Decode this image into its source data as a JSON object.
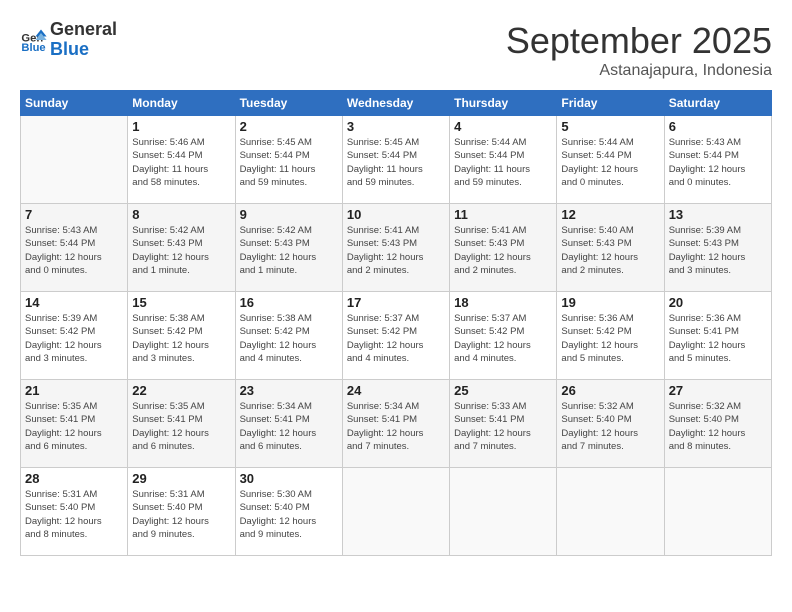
{
  "header": {
    "logo_line1": "General",
    "logo_line2": "Blue",
    "month": "September 2025",
    "location": "Astanajapura, Indonesia"
  },
  "days_of_week": [
    "Sunday",
    "Monday",
    "Tuesday",
    "Wednesday",
    "Thursday",
    "Friday",
    "Saturday"
  ],
  "weeks": [
    [
      {
        "day": "",
        "info": ""
      },
      {
        "day": "1",
        "info": "Sunrise: 5:46 AM\nSunset: 5:44 PM\nDaylight: 11 hours\nand 58 minutes."
      },
      {
        "day": "2",
        "info": "Sunrise: 5:45 AM\nSunset: 5:44 PM\nDaylight: 11 hours\nand 59 minutes."
      },
      {
        "day": "3",
        "info": "Sunrise: 5:45 AM\nSunset: 5:44 PM\nDaylight: 11 hours\nand 59 minutes."
      },
      {
        "day": "4",
        "info": "Sunrise: 5:44 AM\nSunset: 5:44 PM\nDaylight: 11 hours\nand 59 minutes."
      },
      {
        "day": "5",
        "info": "Sunrise: 5:44 AM\nSunset: 5:44 PM\nDaylight: 12 hours\nand 0 minutes."
      },
      {
        "day": "6",
        "info": "Sunrise: 5:43 AM\nSunset: 5:44 PM\nDaylight: 12 hours\nand 0 minutes."
      }
    ],
    [
      {
        "day": "7",
        "info": "Sunrise: 5:43 AM\nSunset: 5:44 PM\nDaylight: 12 hours\nand 0 minutes."
      },
      {
        "day": "8",
        "info": "Sunrise: 5:42 AM\nSunset: 5:43 PM\nDaylight: 12 hours\nand 1 minute."
      },
      {
        "day": "9",
        "info": "Sunrise: 5:42 AM\nSunset: 5:43 PM\nDaylight: 12 hours\nand 1 minute."
      },
      {
        "day": "10",
        "info": "Sunrise: 5:41 AM\nSunset: 5:43 PM\nDaylight: 12 hours\nand 2 minutes."
      },
      {
        "day": "11",
        "info": "Sunrise: 5:41 AM\nSunset: 5:43 PM\nDaylight: 12 hours\nand 2 minutes."
      },
      {
        "day": "12",
        "info": "Sunrise: 5:40 AM\nSunset: 5:43 PM\nDaylight: 12 hours\nand 2 minutes."
      },
      {
        "day": "13",
        "info": "Sunrise: 5:39 AM\nSunset: 5:43 PM\nDaylight: 12 hours\nand 3 minutes."
      }
    ],
    [
      {
        "day": "14",
        "info": "Sunrise: 5:39 AM\nSunset: 5:42 PM\nDaylight: 12 hours\nand 3 minutes."
      },
      {
        "day": "15",
        "info": "Sunrise: 5:38 AM\nSunset: 5:42 PM\nDaylight: 12 hours\nand 3 minutes."
      },
      {
        "day": "16",
        "info": "Sunrise: 5:38 AM\nSunset: 5:42 PM\nDaylight: 12 hours\nand 4 minutes."
      },
      {
        "day": "17",
        "info": "Sunrise: 5:37 AM\nSunset: 5:42 PM\nDaylight: 12 hours\nand 4 minutes."
      },
      {
        "day": "18",
        "info": "Sunrise: 5:37 AM\nSunset: 5:42 PM\nDaylight: 12 hours\nand 4 minutes."
      },
      {
        "day": "19",
        "info": "Sunrise: 5:36 AM\nSunset: 5:42 PM\nDaylight: 12 hours\nand 5 minutes."
      },
      {
        "day": "20",
        "info": "Sunrise: 5:36 AM\nSunset: 5:41 PM\nDaylight: 12 hours\nand 5 minutes."
      }
    ],
    [
      {
        "day": "21",
        "info": "Sunrise: 5:35 AM\nSunset: 5:41 PM\nDaylight: 12 hours\nand 6 minutes."
      },
      {
        "day": "22",
        "info": "Sunrise: 5:35 AM\nSunset: 5:41 PM\nDaylight: 12 hours\nand 6 minutes."
      },
      {
        "day": "23",
        "info": "Sunrise: 5:34 AM\nSunset: 5:41 PM\nDaylight: 12 hours\nand 6 minutes."
      },
      {
        "day": "24",
        "info": "Sunrise: 5:34 AM\nSunset: 5:41 PM\nDaylight: 12 hours\nand 7 minutes."
      },
      {
        "day": "25",
        "info": "Sunrise: 5:33 AM\nSunset: 5:41 PM\nDaylight: 12 hours\nand 7 minutes."
      },
      {
        "day": "26",
        "info": "Sunrise: 5:32 AM\nSunset: 5:40 PM\nDaylight: 12 hours\nand 7 minutes."
      },
      {
        "day": "27",
        "info": "Sunrise: 5:32 AM\nSunset: 5:40 PM\nDaylight: 12 hours\nand 8 minutes."
      }
    ],
    [
      {
        "day": "28",
        "info": "Sunrise: 5:31 AM\nSunset: 5:40 PM\nDaylight: 12 hours\nand 8 minutes."
      },
      {
        "day": "29",
        "info": "Sunrise: 5:31 AM\nSunset: 5:40 PM\nDaylight: 12 hours\nand 9 minutes."
      },
      {
        "day": "30",
        "info": "Sunrise: 5:30 AM\nSunset: 5:40 PM\nDaylight: 12 hours\nand 9 minutes."
      },
      {
        "day": "",
        "info": ""
      },
      {
        "day": "",
        "info": ""
      },
      {
        "day": "",
        "info": ""
      },
      {
        "day": "",
        "info": ""
      }
    ]
  ]
}
